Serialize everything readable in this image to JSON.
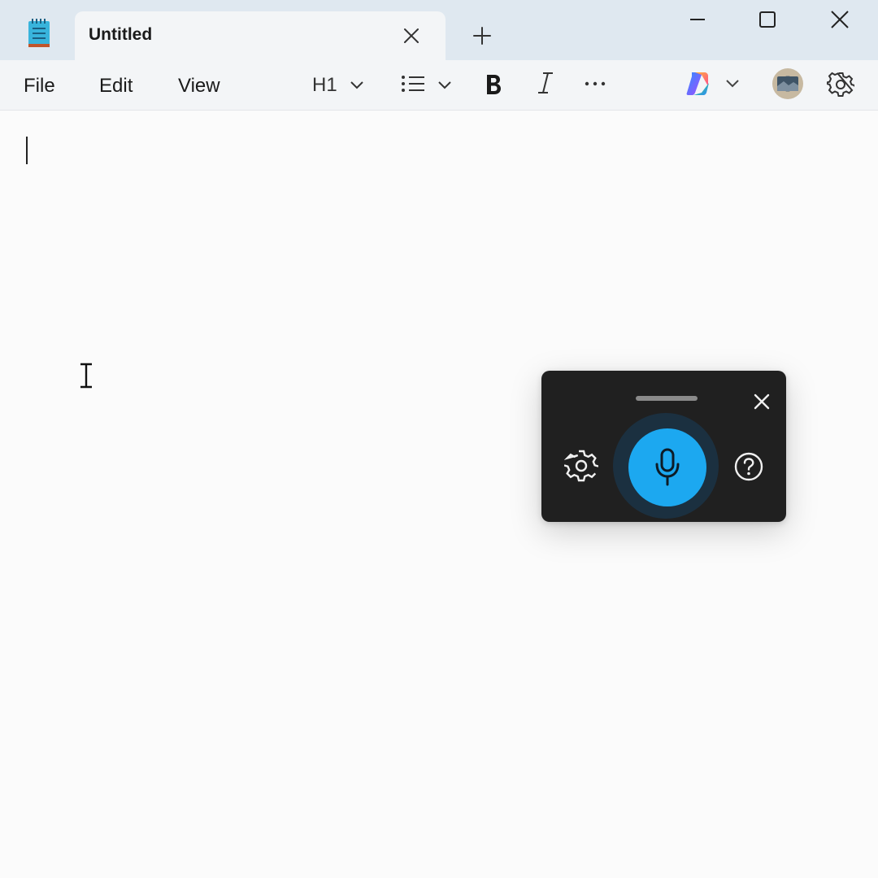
{
  "titlebar": {
    "tab_title": "Untitled",
    "icons": {
      "app": "notepad-icon",
      "tab_close": "close-icon",
      "new_tab": "plus-icon",
      "minimize": "minimize-icon",
      "maximize": "maximize-icon",
      "close": "close-icon"
    }
  },
  "menu": {
    "items": [
      {
        "label": "File"
      },
      {
        "label": "Edit"
      },
      {
        "label": "View"
      }
    ]
  },
  "toolbar": {
    "heading_label": "H1",
    "icons": {
      "heading_dropdown": "chevron-down-icon",
      "list": "bulleted-list-icon",
      "list_dropdown": "chevron-down-icon",
      "bold": "bold-icon",
      "italic": "italic-icon",
      "more": "more-icon",
      "copilot": "copilot-icon",
      "copilot_dropdown": "chevron-down-icon",
      "account": "avatar",
      "settings": "gear-icon"
    }
  },
  "editor": {
    "text": ""
  },
  "voice_panel": {
    "icons": {
      "close": "close-icon",
      "settings": "gear-icon",
      "microphone": "microphone-icon",
      "help": "help-icon"
    },
    "colors": {
      "panel_bg": "#202020",
      "mic_accent": "#1ca8f0"
    }
  }
}
